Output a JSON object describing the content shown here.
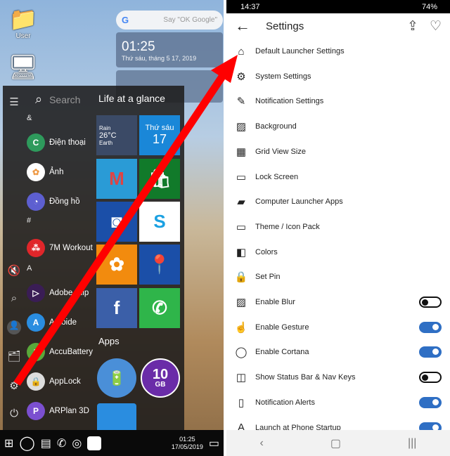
{
  "left": {
    "desktop": {
      "icons": [
        {
          "label": "User"
        }
      ]
    },
    "google_bar": {
      "placeholder": "Say \"OK Google\"",
      "logo": "G"
    },
    "clock_widget": {
      "time": "01:25",
      "date": "Thứ sáu, tháng 5 17, 2019"
    },
    "start_menu": {
      "search_placeholder": "Search",
      "section_title": "Life at a glance",
      "letters": [
        "&",
        "#",
        "A"
      ],
      "apps": [
        {
          "label": "Điện thoại",
          "color": "#2e9a5c",
          "glyph": "C"
        },
        {
          "label": "Ảnh",
          "color": "#ffffff",
          "glyph": "✿"
        },
        {
          "label": "Đồng hồ",
          "color": "#5d5fd0",
          "glyph": "◔"
        },
        {
          "label": "7M Workout",
          "color": "#e0262a",
          "glyph": "⁂"
        },
        {
          "label": "Adobe Clip",
          "color": "#3a1d55",
          "glyph": "▷"
        },
        {
          "label": "Aptoide",
          "color": "#2a8de0",
          "glyph": "A"
        },
        {
          "label": "AccuBattery",
          "color": "#5aa83a",
          "glyph": "▮"
        },
        {
          "label": "AppLock",
          "color": "#dddddd",
          "glyph": "🔒"
        },
        {
          "label": "ARPlan 3D",
          "color": "#7b4fd0",
          "glyph": "P"
        }
      ],
      "weather_tile": {
        "condition": "Rain",
        "temp": "26°C",
        "place": "Earth"
      },
      "calendar_tile": {
        "day": "Thứ sáu",
        "date": "17"
      },
      "apps_label": "Apps",
      "storage_circle": {
        "value": "10",
        "unit": "GB"
      }
    },
    "taskbar": {
      "time": "01:25",
      "date": "17/05/2019"
    }
  },
  "right": {
    "status": {
      "time": "14:37",
      "battery": "74%"
    },
    "title": "Settings",
    "items": [
      {
        "label": "Default Launcher Settings",
        "icon": "home-icon",
        "glyph": "⌂"
      },
      {
        "label": "System Settings",
        "icon": "gear-icon",
        "glyph": "⚙"
      },
      {
        "label": "Notification Settings",
        "icon": "pin-icon",
        "glyph": "✎"
      },
      {
        "label": "Background",
        "icon": "image-icon",
        "glyph": "▨"
      },
      {
        "label": "Grid View Size",
        "icon": "grid-icon",
        "glyph": "▦"
      },
      {
        "label": "Lock Screen",
        "icon": "lock-screen-icon",
        "glyph": "▭"
      },
      {
        "label": "Computer Launcher Apps",
        "icon": "bag-icon",
        "glyph": "▰"
      },
      {
        "label": "Theme / Icon Pack",
        "icon": "monitor-icon",
        "glyph": "▭"
      },
      {
        "label": "Colors",
        "icon": "colors-icon",
        "glyph": "◧"
      },
      {
        "label": "Set Pin",
        "icon": "lock-icon",
        "glyph": "🔒"
      },
      {
        "label": "Enable Blur",
        "icon": "image-icon",
        "glyph": "▨",
        "toggle": false
      },
      {
        "label": "Enable Gesture",
        "icon": "gesture-icon",
        "glyph": "☝",
        "toggle": true
      },
      {
        "label": "Enable Cortana",
        "icon": "cortana-icon",
        "glyph": "◯",
        "toggle": true
      },
      {
        "label": "Show Status Bar & Nav Keys",
        "icon": "statusbar-icon",
        "glyph": "◫",
        "toggle": false
      },
      {
        "label": "Notification Alerts",
        "icon": "vibrate-icon",
        "glyph": "▯",
        "toggle": true
      },
      {
        "label": "Launch at Phone Startup",
        "icon": "startup-icon",
        "glyph": "A",
        "toggle": true
      }
    ],
    "accent": "#2f6fc4"
  }
}
